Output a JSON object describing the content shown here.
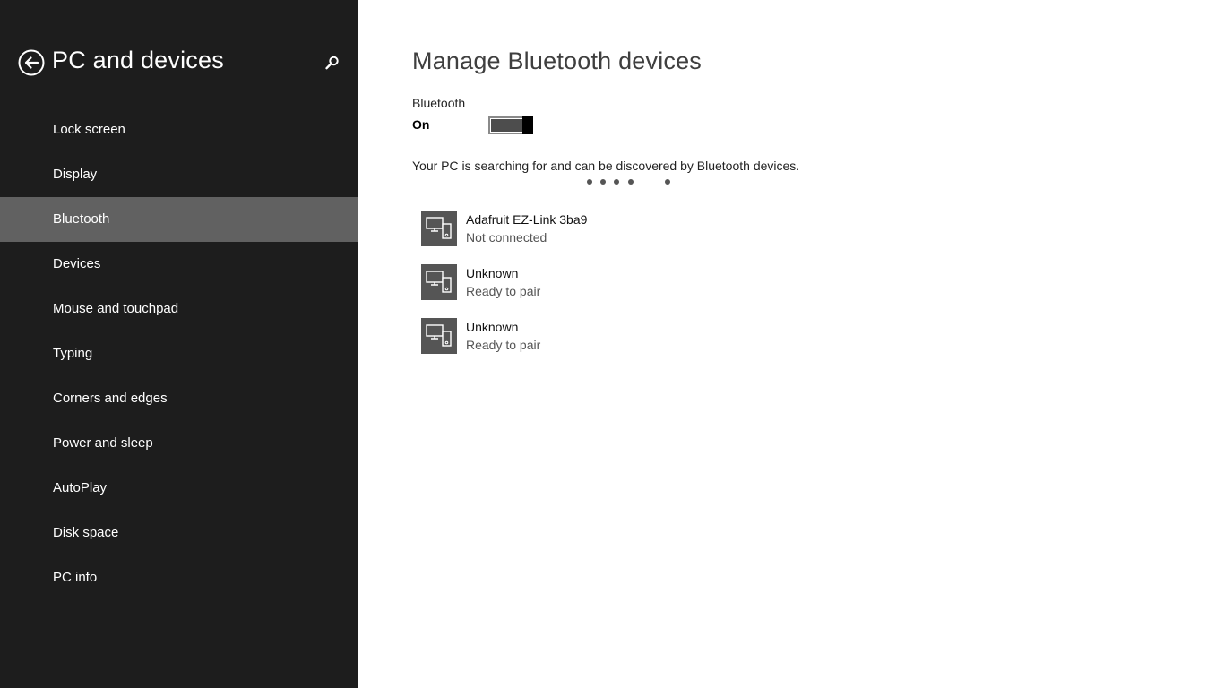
{
  "sidebar": {
    "title": "PC and devices",
    "back_icon": "back-arrow-icon",
    "search_icon": "search-icon",
    "items": [
      {
        "label": "Lock screen"
      },
      {
        "label": "Display"
      },
      {
        "label": "Bluetooth"
      },
      {
        "label": "Devices"
      },
      {
        "label": "Mouse and touchpad"
      },
      {
        "label": "Typing"
      },
      {
        "label": "Corners and edges"
      },
      {
        "label": "Power and sleep"
      },
      {
        "label": "AutoPlay"
      },
      {
        "label": "Disk space"
      },
      {
        "label": "PC info"
      }
    ],
    "selected_index": 2
  },
  "main": {
    "title": "Manage Bluetooth devices",
    "bluetooth": {
      "label": "Bluetooth",
      "state": "On",
      "enabled": true
    },
    "status_text": "Your PC is searching for and can be discovered by Bluetooth devices.",
    "devices": [
      {
        "name": "Adafruit EZ-Link 3ba9",
        "status": "Not connected",
        "icon": "pc-and-phone-icon"
      },
      {
        "name": "Unknown",
        "status": "Ready to pair",
        "icon": "pc-and-phone-icon"
      },
      {
        "name": "Unknown",
        "status": "Ready to pair",
        "icon": "pc-and-phone-icon"
      }
    ]
  },
  "colors": {
    "sidebar_bg": "#1d1d1d",
    "sidebar_selected": "#616161",
    "tile_bg": "#555555",
    "main_bg": "#ffffff"
  }
}
